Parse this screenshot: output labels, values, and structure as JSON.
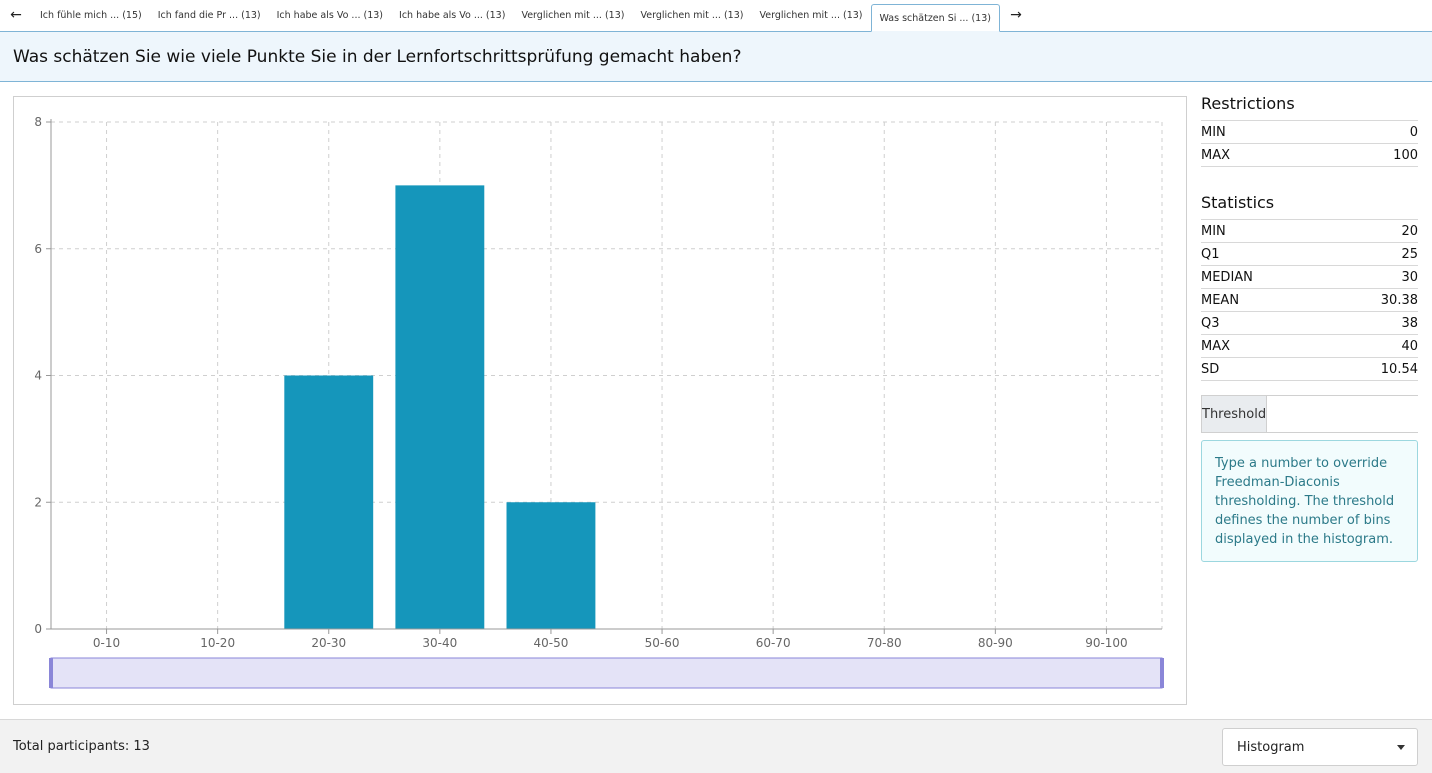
{
  "tabs": {
    "prev_arrow": "←",
    "next_arrow": "→",
    "items": [
      {
        "label": "Ich fühle mich ... (15)",
        "active": false
      },
      {
        "label": "Ich fand die Pr ... (13)",
        "active": false
      },
      {
        "label": "Ich habe als Vo ... (13)",
        "active": false
      },
      {
        "label": "Ich habe als Vo ... (13)",
        "active": false
      },
      {
        "label": "Verglichen mit ... (13)",
        "active": false
      },
      {
        "label": "Verglichen mit ... (13)",
        "active": false
      },
      {
        "label": "Verglichen mit ... (13)",
        "active": false
      },
      {
        "label": "Was schätzen Si ... (13)",
        "active": true
      }
    ]
  },
  "question": {
    "title": "Was schätzen Sie wie viele Punkte Sie in der Lernfortschrittsprüfung gemacht haben?"
  },
  "chart_data": {
    "type": "bar",
    "categories": [
      "0-10",
      "10-20",
      "20-30",
      "30-40",
      "40-50",
      "50-60",
      "60-70",
      "70-80",
      "80-90",
      "90-100"
    ],
    "values": [
      0,
      0,
      4,
      7,
      2,
      0,
      0,
      0,
      0,
      0
    ],
    "ylim": [
      0,
      8
    ],
    "yticks": [
      0,
      2,
      4,
      6,
      8
    ],
    "grid": true,
    "bar_color": "#1596bb",
    "range_brush": "full"
  },
  "restrictions": {
    "heading": "Restrictions",
    "rows": [
      {
        "key": "MIN",
        "value": "0"
      },
      {
        "key": "MAX",
        "value": "100"
      }
    ]
  },
  "statistics": {
    "heading": "Statistics",
    "rows": [
      {
        "key": "MIN",
        "value": "20"
      },
      {
        "key": "Q1",
        "value": "25"
      },
      {
        "key": "MEDIAN",
        "value": "30"
      },
      {
        "key": "MEAN",
        "value": "30.38"
      },
      {
        "key": "Q3",
        "value": "38"
      },
      {
        "key": "MAX",
        "value": "40"
      },
      {
        "key": "SD",
        "value": "10.54"
      }
    ]
  },
  "threshold": {
    "label": "Threshold",
    "value": "",
    "placeholder": ""
  },
  "info": {
    "text": "Type a number to override Freedman-Diaconis thresholding. The threshold defines the number of bins displayed in the histogram."
  },
  "footer": {
    "participants": "Total participants: 13",
    "chart_type_selected": "Histogram"
  },
  "colors": {
    "accent_border": "#7fb4d6",
    "header_bg": "#eef6fc",
    "bar": "#1596bb",
    "brush": "#e4e3f7",
    "brush_border": "#8a86d8"
  }
}
